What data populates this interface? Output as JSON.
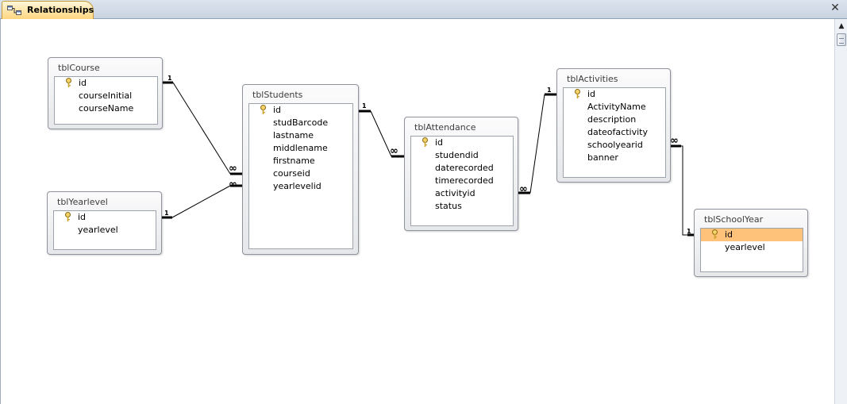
{
  "document_tab": {
    "label": "Relationships"
  },
  "tables": [
    {
      "id": "course",
      "name": "tblCourse",
      "fields": [
        {
          "name": "id",
          "primary_key": true
        },
        {
          "name": "courseInitial"
        },
        {
          "name": "courseName"
        }
      ]
    },
    {
      "id": "yearlevel",
      "name": "tblYearlevel",
      "fields": [
        {
          "name": "id",
          "primary_key": true
        },
        {
          "name": "yearlevel"
        }
      ]
    },
    {
      "id": "students",
      "name": "tblStudents",
      "fields": [
        {
          "name": "id",
          "primary_key": true
        },
        {
          "name": "studBarcode"
        },
        {
          "name": "lastname"
        },
        {
          "name": "middlename"
        },
        {
          "name": "firstname"
        },
        {
          "name": "courseid"
        },
        {
          "name": "yearlevelid"
        }
      ]
    },
    {
      "id": "attendance",
      "name": "tblAttendance",
      "fields": [
        {
          "name": "id",
          "primary_key": true
        },
        {
          "name": "studendid"
        },
        {
          "name": "daterecorded"
        },
        {
          "name": "timerecorded"
        },
        {
          "name": "activityid"
        },
        {
          "name": "status"
        }
      ]
    },
    {
      "id": "activities",
      "name": "tblActivities",
      "fields": [
        {
          "name": "id",
          "primary_key": true
        },
        {
          "name": "ActivityName"
        },
        {
          "name": "description"
        },
        {
          "name": "dateofactivity"
        },
        {
          "name": "schoolyearid"
        },
        {
          "name": "banner"
        }
      ]
    },
    {
      "id": "schoolyear",
      "name": "tblSchoolYear",
      "fields": [
        {
          "name": "id",
          "primary_key": true,
          "selected": true
        },
        {
          "name": "yearlevel"
        }
      ]
    }
  ],
  "relationships": [
    {
      "one_label": "1",
      "many_label": "∞"
    },
    {
      "one_label": "1",
      "many_label": "∞"
    },
    {
      "one_label": "1",
      "many_label": "∞"
    },
    {
      "one_label": "1",
      "many_label": "∞"
    },
    {
      "one_label": "1",
      "many_label": "∞"
    }
  ],
  "colors": {
    "selected_field": "#ffc27a",
    "tab_active": "#ffd680",
    "line": "#000000"
  },
  "icons": {
    "tab": "relationships-icon",
    "primary_key": "key-icon",
    "close": "close-icon",
    "scroll_up": "scroll-up-arrow-icon"
  }
}
